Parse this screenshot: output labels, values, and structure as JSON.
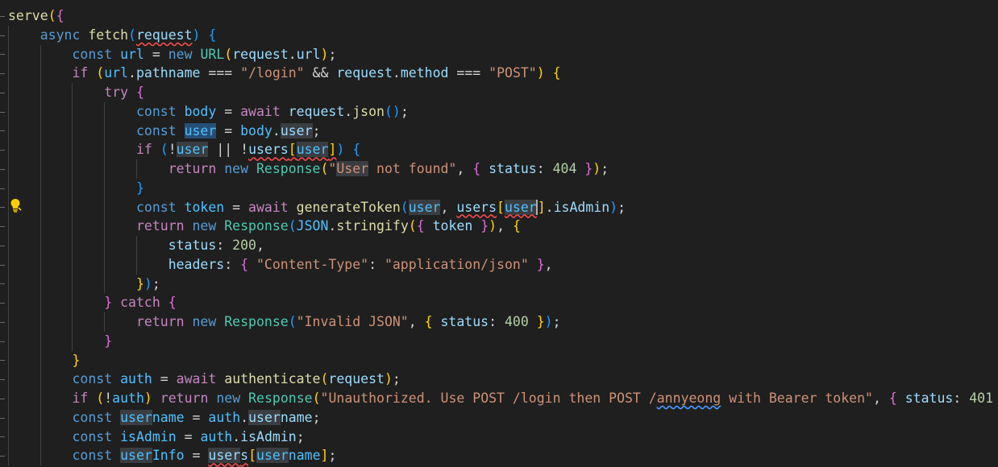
{
  "editor": {
    "language": "javascript",
    "lightbulb_icon": "lightbulb-icon",
    "lightbulb_line": 11,
    "colors": {
      "background": "#1f1f1f",
      "keyword": "#569cd6",
      "control": "#c586c0",
      "variable": "#9cdcfe",
      "function": "#dcdcaa",
      "class": "#4ec9b0",
      "string": "#ce9178",
      "number": "#b5cea8",
      "bracket_1": "#ffd700",
      "bracket_2": "#da70d6",
      "bracket_3": "#179fff",
      "highlight": "#264f78"
    },
    "lines": [
      {
        "indent": 0,
        "tokens": [
          {
            "t": "serve",
            "c": "fn"
          },
          {
            "t": "(",
            "c": "b1"
          },
          {
            "t": "{",
            "c": "b2"
          }
        ]
      },
      {
        "indent": 1,
        "tokens": [
          {
            "t": "async ",
            "c": "kw"
          },
          {
            "t": "fetch",
            "c": "fn"
          },
          {
            "t": "(",
            "c": "b3"
          },
          {
            "t": "request",
            "c": "var sq"
          },
          {
            "t": ")",
            "c": "b3"
          },
          {
            "t": " ",
            "c": "op"
          },
          {
            "t": "{",
            "c": "b3"
          }
        ]
      },
      {
        "indent": 2,
        "tokens": [
          {
            "t": "const ",
            "c": "kw"
          },
          {
            "t": "url",
            "c": "cst"
          },
          {
            "t": " = ",
            "c": "op"
          },
          {
            "t": "new ",
            "c": "kw"
          },
          {
            "t": "URL",
            "c": "cls"
          },
          {
            "t": "(",
            "c": "b1"
          },
          {
            "t": "request",
            "c": "var"
          },
          {
            "t": ".",
            "c": "op"
          },
          {
            "t": "url",
            "c": "var"
          },
          {
            "t": ")",
            "c": "b1"
          },
          {
            "t": ";",
            "c": "op"
          }
        ]
      },
      {
        "indent": 2,
        "tokens": [
          {
            "t": "if ",
            "c": "ctl"
          },
          {
            "t": "(",
            "c": "b1"
          },
          {
            "t": "url",
            "c": "cst"
          },
          {
            "t": ".",
            "c": "op"
          },
          {
            "t": "pathname",
            "c": "var"
          },
          {
            "t": " === ",
            "c": "op"
          },
          {
            "t": "\"/login\"",
            "c": "str"
          },
          {
            "t": " && ",
            "c": "op"
          },
          {
            "t": "request",
            "c": "var"
          },
          {
            "t": ".",
            "c": "op"
          },
          {
            "t": "method",
            "c": "var"
          },
          {
            "t": " === ",
            "c": "op"
          },
          {
            "t": "\"POST\"",
            "c": "str"
          },
          {
            "t": ")",
            "c": "b1"
          },
          {
            "t": " ",
            "c": "op"
          },
          {
            "t": "{",
            "c": "b1"
          }
        ]
      },
      {
        "indent": 3,
        "tokens": [
          {
            "t": "try ",
            "c": "ctl"
          },
          {
            "t": "{",
            "c": "b2"
          }
        ]
      },
      {
        "indent": 4,
        "tokens": [
          {
            "t": "const ",
            "c": "kw"
          },
          {
            "t": "body",
            "c": "cst"
          },
          {
            "t": " = ",
            "c": "op"
          },
          {
            "t": "await ",
            "c": "ctl"
          },
          {
            "t": "request",
            "c": "var"
          },
          {
            "t": ".",
            "c": "op"
          },
          {
            "t": "json",
            "c": "fn"
          },
          {
            "t": "(",
            "c": "b3"
          },
          {
            "t": ")",
            "c": "b3"
          },
          {
            "t": ";",
            "c": "op"
          }
        ]
      },
      {
        "indent": 4,
        "tokens": [
          {
            "t": "const ",
            "c": "kw"
          },
          {
            "t": "user",
            "c": "cst hl"
          },
          {
            "t": " = ",
            "c": "op"
          },
          {
            "t": "body",
            "c": "cst"
          },
          {
            "t": ".",
            "c": "op"
          },
          {
            "t": "user",
            "c": "var hl2"
          },
          {
            "t": ";",
            "c": "op"
          }
        ]
      },
      {
        "indent": 4,
        "tokens": [
          {
            "t": "if ",
            "c": "ctl"
          },
          {
            "t": "(",
            "c": "b3"
          },
          {
            "t": "!",
            "c": "op"
          },
          {
            "t": "user",
            "c": "cst hl2"
          },
          {
            "t": " || ",
            "c": "op"
          },
          {
            "t": "!",
            "c": "op"
          },
          {
            "t": "users",
            "c": "var sq"
          },
          {
            "t": "[",
            "c": "b1 sq"
          },
          {
            "t": "user",
            "c": "cst hl2 sq"
          },
          {
            "t": "]",
            "c": "b1 sq"
          },
          {
            "t": ")",
            "c": "b3"
          },
          {
            "t": " ",
            "c": "op"
          },
          {
            "t": "{",
            "c": "b3"
          }
        ]
      },
      {
        "indent": 5,
        "tokens": [
          {
            "t": "return ",
            "c": "ctl"
          },
          {
            "t": "new ",
            "c": "kw"
          },
          {
            "t": "Response",
            "c": "cls"
          },
          {
            "t": "(",
            "c": "b1"
          },
          {
            "t": "\"",
            "c": "str"
          },
          {
            "t": "User",
            "c": "str hl2"
          },
          {
            "t": " not found\"",
            "c": "str"
          },
          {
            "t": ", ",
            "c": "op"
          },
          {
            "t": "{",
            "c": "b2"
          },
          {
            "t": " ",
            "c": "op"
          },
          {
            "t": "status",
            "c": "var"
          },
          {
            "t": ": ",
            "c": "op"
          },
          {
            "t": "404",
            "c": "num"
          },
          {
            "t": " ",
            "c": "op"
          },
          {
            "t": "}",
            "c": "b2"
          },
          {
            "t": ")",
            "c": "b1"
          },
          {
            "t": ";",
            "c": "op"
          }
        ]
      },
      {
        "indent": 4,
        "tokens": [
          {
            "t": "}",
            "c": "b3"
          }
        ]
      },
      {
        "indent": 4,
        "tokens": [
          {
            "t": "const ",
            "c": "kw"
          },
          {
            "t": "token",
            "c": "cst"
          },
          {
            "t": " = ",
            "c": "op"
          },
          {
            "t": "await ",
            "c": "ctl"
          },
          {
            "t": "generateToken",
            "c": "fn"
          },
          {
            "t": "(",
            "c": "b3"
          },
          {
            "t": "user",
            "c": "cst hl2"
          },
          {
            "t": ", ",
            "c": "op"
          },
          {
            "t": "users",
            "c": "var sq"
          },
          {
            "t": "[",
            "c": "b1"
          },
          {
            "t": "user",
            "c": "cst hl2 sq"
          },
          {
            "t": "]",
            "c": "b1 cursor"
          },
          {
            "t": ".",
            "c": "op"
          },
          {
            "t": "isAdmin",
            "c": "var"
          },
          {
            "t": ")",
            "c": "b3"
          },
          {
            "t": ";",
            "c": "op"
          }
        ]
      },
      {
        "indent": 4,
        "tokens": [
          {
            "t": "return ",
            "c": "ctl"
          },
          {
            "t": "new ",
            "c": "kw"
          },
          {
            "t": "Response",
            "c": "cls"
          },
          {
            "t": "(",
            "c": "b3"
          },
          {
            "t": "JSON",
            "c": "cst"
          },
          {
            "t": ".",
            "c": "op"
          },
          {
            "t": "stringify",
            "c": "fn"
          },
          {
            "t": "(",
            "c": "b1"
          },
          {
            "t": "{",
            "c": "b2"
          },
          {
            "t": " ",
            "c": "op"
          },
          {
            "t": "token",
            "c": "var"
          },
          {
            "t": " ",
            "c": "op"
          },
          {
            "t": "}",
            "c": "b2"
          },
          {
            "t": ")",
            "c": "b1"
          },
          {
            "t": ", ",
            "c": "op"
          },
          {
            "t": "{",
            "c": "b1"
          }
        ]
      },
      {
        "indent": 5,
        "tokens": [
          {
            "t": "status",
            "c": "var"
          },
          {
            "t": ": ",
            "c": "op"
          },
          {
            "t": "200",
            "c": "num"
          },
          {
            "t": ",",
            "c": "op"
          }
        ]
      },
      {
        "indent": 5,
        "tokens": [
          {
            "t": "headers",
            "c": "var"
          },
          {
            "t": ": ",
            "c": "op"
          },
          {
            "t": "{",
            "c": "b2"
          },
          {
            "t": " ",
            "c": "op"
          },
          {
            "t": "\"Content-Type\"",
            "c": "str"
          },
          {
            "t": ": ",
            "c": "op"
          },
          {
            "t": "\"application/json\"",
            "c": "str"
          },
          {
            "t": " ",
            "c": "op"
          },
          {
            "t": "}",
            "c": "b2"
          },
          {
            "t": ",",
            "c": "op"
          }
        ]
      },
      {
        "indent": 4,
        "tokens": [
          {
            "t": "}",
            "c": "b1"
          },
          {
            "t": ")",
            "c": "b3"
          },
          {
            "t": ";",
            "c": "op"
          }
        ]
      },
      {
        "indent": 3,
        "tokens": [
          {
            "t": "}",
            "c": "b2"
          },
          {
            "t": " ",
            "c": "op"
          },
          {
            "t": "catch ",
            "c": "ctl"
          },
          {
            "t": "{",
            "c": "b2"
          }
        ]
      },
      {
        "indent": 4,
        "tokens": [
          {
            "t": "return ",
            "c": "ctl"
          },
          {
            "t": "new ",
            "c": "kw"
          },
          {
            "t": "Response",
            "c": "cls"
          },
          {
            "t": "(",
            "c": "b3"
          },
          {
            "t": "\"Invalid JSON\"",
            "c": "str"
          },
          {
            "t": ", ",
            "c": "op"
          },
          {
            "t": "{",
            "c": "b1"
          },
          {
            "t": " ",
            "c": "op"
          },
          {
            "t": "status",
            "c": "var"
          },
          {
            "t": ": ",
            "c": "op"
          },
          {
            "t": "400",
            "c": "num"
          },
          {
            "t": " ",
            "c": "op"
          },
          {
            "t": "}",
            "c": "b1"
          },
          {
            "t": ")",
            "c": "b3"
          },
          {
            "t": ";",
            "c": "op"
          }
        ]
      },
      {
        "indent": 3,
        "tokens": [
          {
            "t": "}",
            "c": "b2"
          }
        ]
      },
      {
        "indent": 2,
        "tokens": [
          {
            "t": "}",
            "c": "b1"
          }
        ]
      },
      {
        "indent": 2,
        "tokens": [
          {
            "t": "const ",
            "c": "kw"
          },
          {
            "t": "auth",
            "c": "cst"
          },
          {
            "t": " = ",
            "c": "op"
          },
          {
            "t": "await ",
            "c": "ctl"
          },
          {
            "t": "authenticate",
            "c": "fn"
          },
          {
            "t": "(",
            "c": "b1"
          },
          {
            "t": "request",
            "c": "var"
          },
          {
            "t": ")",
            "c": "b1"
          },
          {
            "t": ";",
            "c": "op"
          }
        ]
      },
      {
        "indent": 2,
        "tokens": [
          {
            "t": "if ",
            "c": "ctl"
          },
          {
            "t": "(",
            "c": "b1"
          },
          {
            "t": "!",
            "c": "op"
          },
          {
            "t": "auth",
            "c": "cst"
          },
          {
            "t": ")",
            "c": "b1"
          },
          {
            "t": " ",
            "c": "op"
          },
          {
            "t": "return ",
            "c": "ctl"
          },
          {
            "t": "new ",
            "c": "kw"
          },
          {
            "t": "Response",
            "c": "cls"
          },
          {
            "t": "(",
            "c": "b1"
          },
          {
            "t": "\"Unauthorized. Use POST /login then POST /",
            "c": "str"
          },
          {
            "t": "annyeong",
            "c": "str sqb"
          },
          {
            "t": " with Bearer token\"",
            "c": "str"
          },
          {
            "t": ", ",
            "c": "op"
          },
          {
            "t": "{",
            "c": "b2"
          },
          {
            "t": " ",
            "c": "op"
          },
          {
            "t": "status",
            "c": "var"
          },
          {
            "t": ": ",
            "c": "op"
          },
          {
            "t": "401",
            "c": "num"
          },
          {
            "t": " ",
            "c": "op"
          },
          {
            "t": "}",
            "c": "b2"
          },
          {
            "t": ")",
            "c": "b1"
          },
          {
            "t": ";",
            "c": "op"
          }
        ]
      },
      {
        "indent": 2,
        "tokens": [
          {
            "t": "const ",
            "c": "kw"
          },
          {
            "t": "user",
            "c": "cst hl2"
          },
          {
            "t": "name",
            "c": "cst"
          },
          {
            "t": " = ",
            "c": "op"
          },
          {
            "t": "auth",
            "c": "cst"
          },
          {
            "t": ".",
            "c": "op"
          },
          {
            "t": "user",
            "c": "var hl2"
          },
          {
            "t": "name",
            "c": "var"
          },
          {
            "t": ";",
            "c": "op"
          }
        ]
      },
      {
        "indent": 2,
        "tokens": [
          {
            "t": "const ",
            "c": "kw"
          },
          {
            "t": "isAdmin",
            "c": "cst"
          },
          {
            "t": " = ",
            "c": "op"
          },
          {
            "t": "auth",
            "c": "cst"
          },
          {
            "t": ".",
            "c": "op"
          },
          {
            "t": "isAdmin",
            "c": "var"
          },
          {
            "t": ";",
            "c": "op"
          }
        ]
      },
      {
        "indent": 2,
        "tokens": [
          {
            "t": "const ",
            "c": "kw"
          },
          {
            "t": "user",
            "c": "cst hl2"
          },
          {
            "t": "Info",
            "c": "cst"
          },
          {
            "t": " = ",
            "c": "op"
          },
          {
            "t": "user",
            "c": "var sq hl2"
          },
          {
            "t": "s",
            "c": "var sq"
          },
          {
            "t": "[",
            "c": "b1"
          },
          {
            "t": "user",
            "c": "cst hl2"
          },
          {
            "t": "name",
            "c": "cst"
          },
          {
            "t": "]",
            "c": "b1"
          },
          {
            "t": ";",
            "c": "op"
          }
        ]
      }
    ]
  }
}
